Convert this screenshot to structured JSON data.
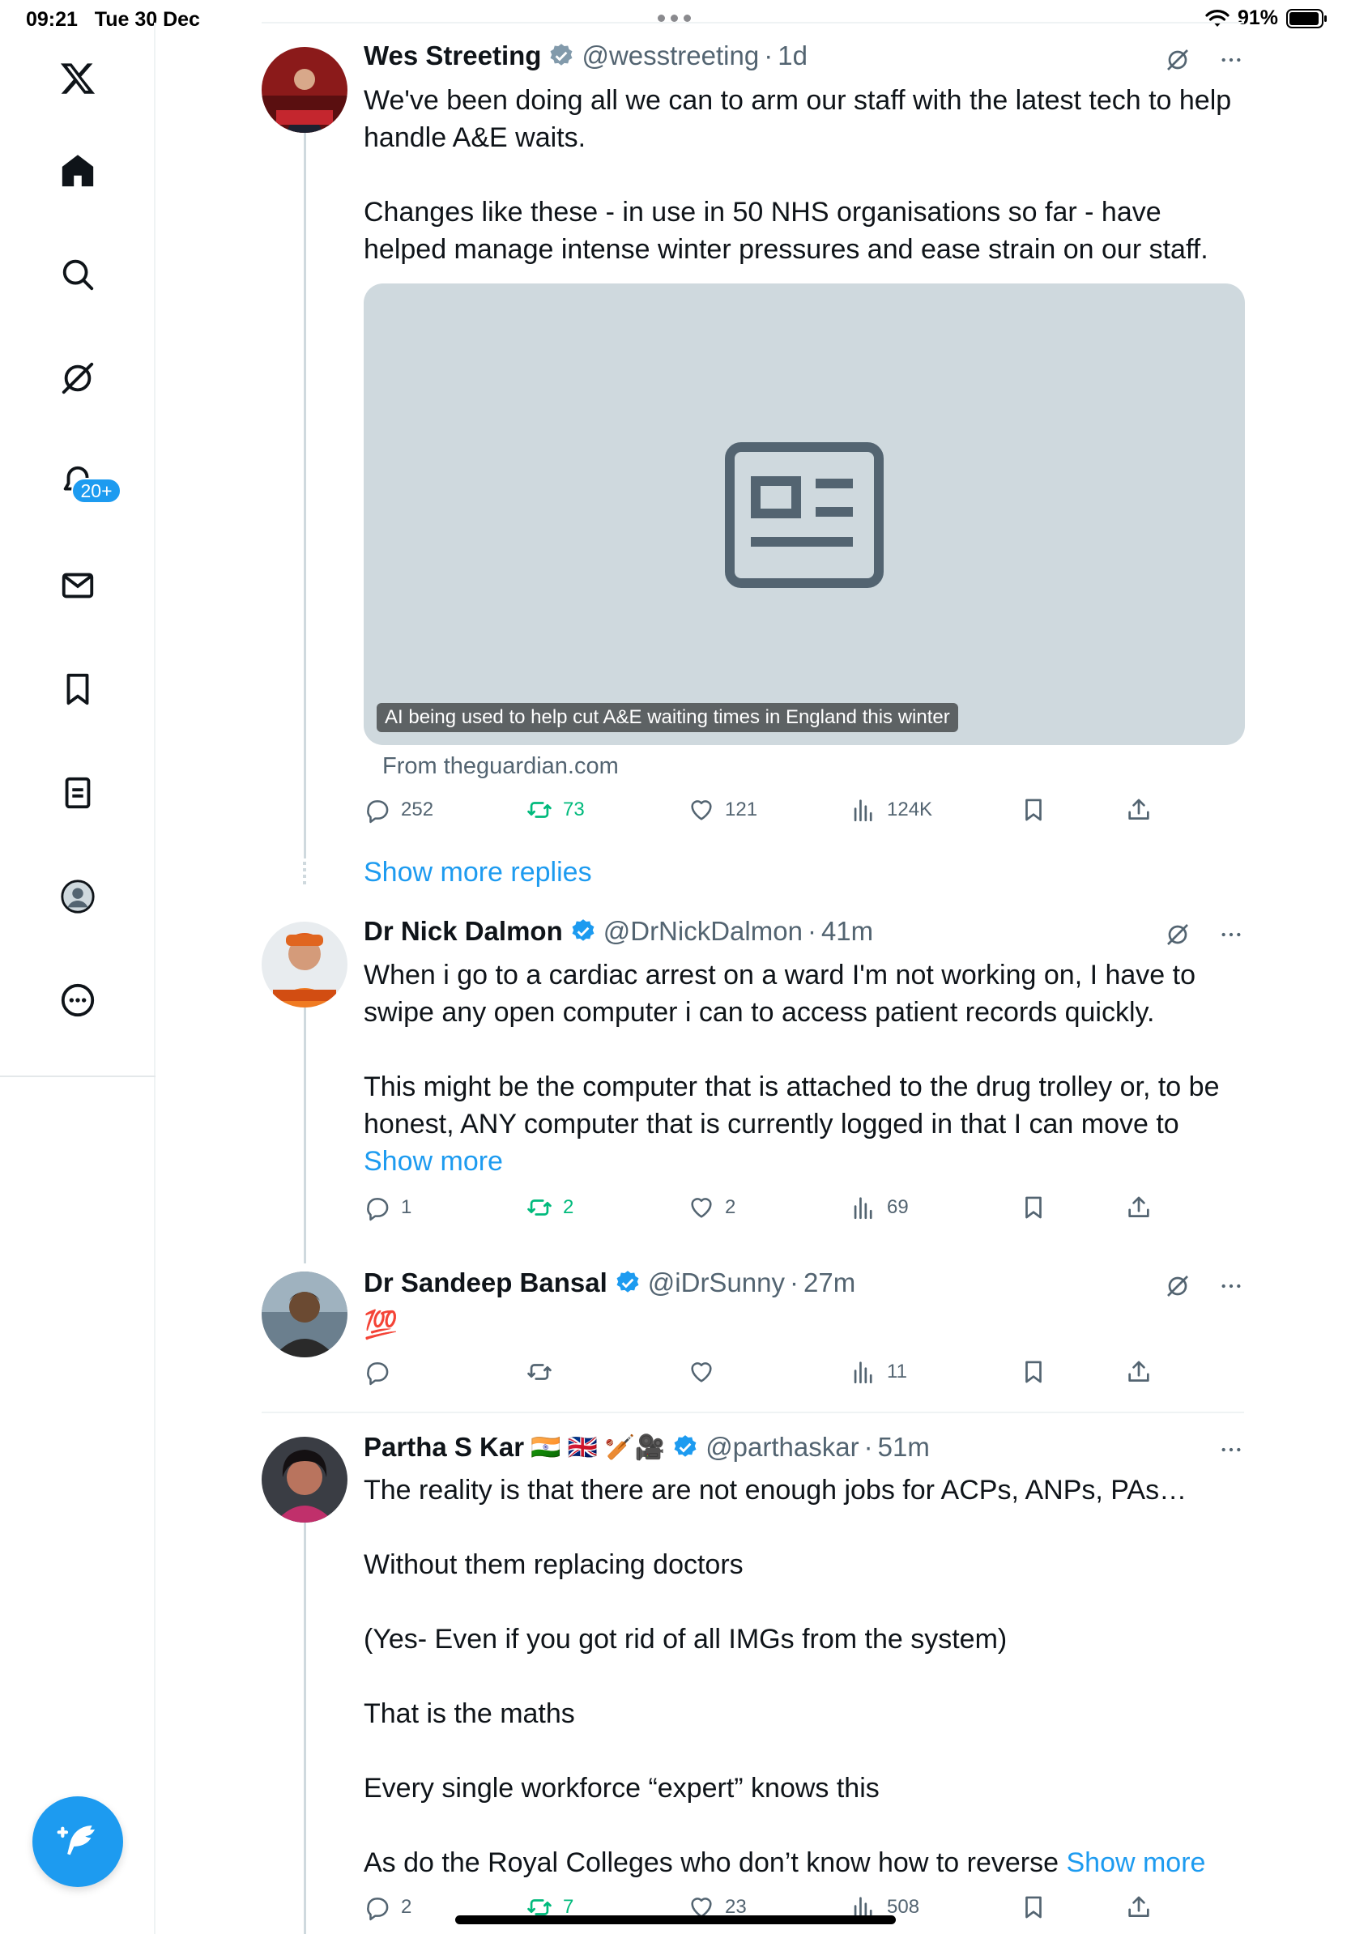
{
  "status_bar": {
    "time": "09:21",
    "date": "Tue 30 Dec",
    "battery": "91%"
  },
  "sidebar": {
    "notifications_badge": "20+"
  },
  "main_tweet": {
    "name": "Wes Streeting",
    "handle": "@wesstreeting",
    "time": "1d",
    "text_lines": [
      "We've been doing all we can to arm our staff with the latest tech to help handle A&E waits.",
      "Changes like these - in use in 50 NHS organisations so far - have helped manage intense winter pressures and ease strain on our staff."
    ],
    "card": {
      "caption": "AI being used to help cut A&E waiting times in England this winter",
      "source": "From theguardian.com"
    },
    "stats": {
      "replies": "252",
      "reposts": "73",
      "likes": "121",
      "views": "124K"
    }
  },
  "show_more_replies": "Show more replies",
  "replies": [
    {
      "name": "Dr Nick Dalmon",
      "handle": "@DrNickDalmon",
      "time": "41m",
      "text_lines": [
        "When i go to a cardiac arrest on a ward I'm not working on, I have to swipe any open computer i can to access patient records quickly.",
        "This might be the computer that is attached to the drug trolley or, to be honest, ANY computer that is currently logged in that I can move to"
      ],
      "show_more": "Show more",
      "stats": {
        "replies": "1",
        "reposts": "2",
        "likes": "2",
        "views": "69"
      }
    },
    {
      "name": "Dr Sandeep Bansal",
      "handle": "@iDrSunny",
      "time": "27m",
      "text": "💯",
      "stats": {
        "replies": "",
        "reposts": "",
        "likes": "",
        "views": "11"
      }
    },
    {
      "name": "Partha S Kar",
      "flags": "🇮🇳 🇬🇧 🏏🎥",
      "handle": "@parthaskar",
      "time": "51m",
      "text_lines": [
        "The reality is that there are not enough jobs for ACPs, ANPs, PAs…",
        "Without them replacing doctors",
        "(Yes- Even if you got rid of all IMGs from the system)",
        "That is the maths",
        "Every single workforce “expert” knows this",
        "As do the Royal Colleges who don’t know how to reverse"
      ],
      "show_more": "Show more",
      "stats": {
        "replies": "2",
        "reposts": "7",
        "likes": "23",
        "views": "508"
      }
    }
  ],
  "icons": [
    "x-logo-icon",
    "home-icon",
    "search-icon",
    "grok-icon",
    "bell-icon",
    "mail-icon",
    "bookmark-icon",
    "list-icon",
    "profile-icon",
    "more-circle-icon",
    "compose-icon",
    "reply-icon",
    "repost-icon",
    "like-icon",
    "views-icon",
    "share-icon",
    "verified-icon",
    "article-icon"
  ],
  "colors": {
    "accent": "#1d9bf0",
    "repost": "#00ba7c",
    "muted": "#536471",
    "card_bg": "#cfd9de"
  }
}
